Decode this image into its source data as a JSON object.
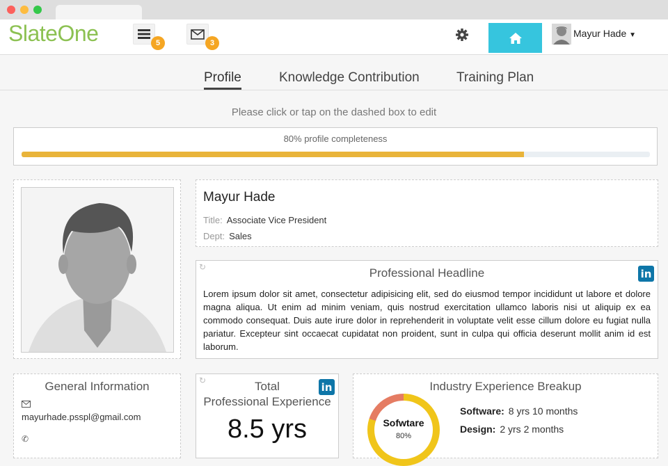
{
  "app": {
    "logo": "SlateOne"
  },
  "header": {
    "menu_badge": "5",
    "mail_badge": "3",
    "user_name": "Mayur Hade"
  },
  "tabs": [
    {
      "label": "Profile",
      "active": true
    },
    {
      "label": "Knowledge Contribution",
      "active": false
    },
    {
      "label": "Training Plan",
      "active": false
    }
  ],
  "hint": "Please click or tap on the dashed box to edit",
  "progress": {
    "label": "80% profile completeness",
    "value": 0.8
  },
  "profile": {
    "name": "Mayur Hade",
    "title_label": "Title:",
    "title": "Associate Vice President",
    "dept_label": "Dept:",
    "dept": "Sales"
  },
  "headline": {
    "title": "Professional Headline",
    "text": "Lorem ipsum dolor sit amet, consectetur adipisicing elit, sed do eiusmod tempor incididunt ut labore et dolore magna aliqua. Ut enim ad minim veniam, quis nostrud exercitation ullamco laboris nisi ut aliquip ex ea commodo consequat. Duis aute irure dolor in reprehenderit in voluptate velit esse cillum dolore eu fugiat nulla pariatur. Excepteur sint occaecat cupidatat non proident, sunt in culpa qui officia deserunt mollit anim id est laborum."
  },
  "general": {
    "title": "General Information",
    "email": "mayurhade.psspl@gmail.com"
  },
  "experience": {
    "title_line1": "Total",
    "title_line2": "Professional Experience",
    "value": "8.5 yrs"
  },
  "industry": {
    "title": "Industry Experience Breakup",
    "donut_label": "Sofwtare",
    "donut_pct": "80%",
    "donut_value": 0.8,
    "rows": [
      {
        "label": "Software:",
        "value": "8 yrs 10 months"
      },
      {
        "label": "Design:",
        "value": "2 yrs 2 months"
      }
    ]
  },
  "colors": {
    "brand": "#8cc152",
    "home": "#36c5de",
    "badge": "#f5a623",
    "progress": "#e9b43a",
    "linkedin": "#0e76a8"
  }
}
